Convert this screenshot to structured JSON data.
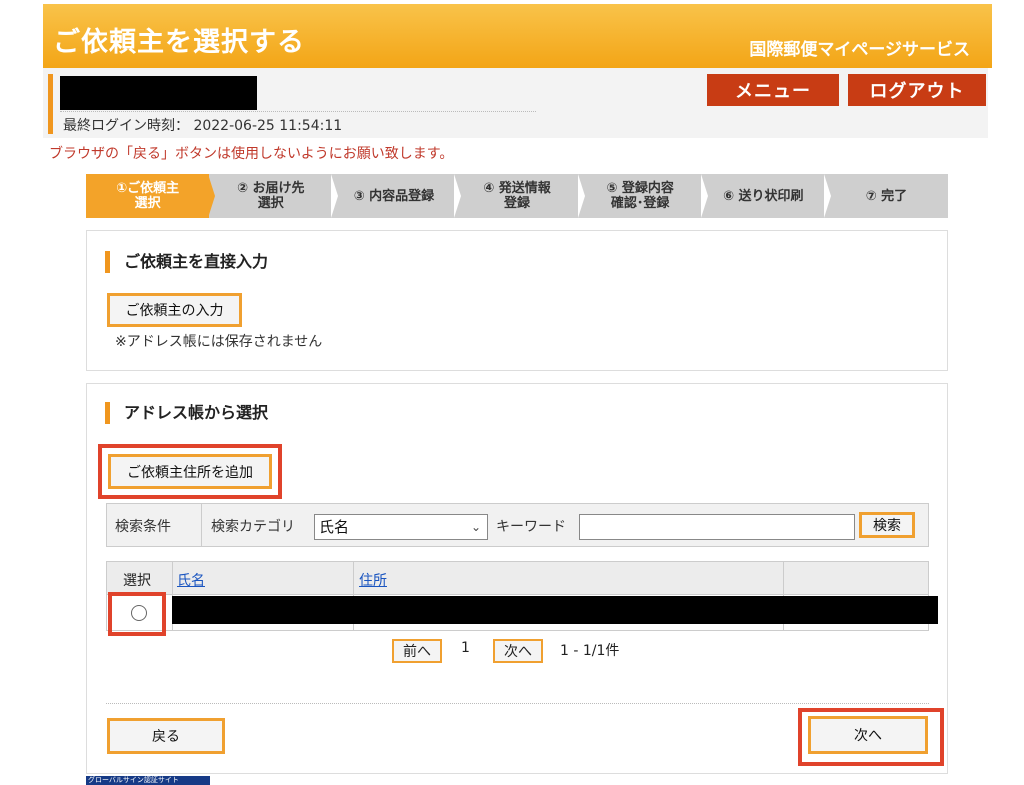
{
  "header": {
    "title": "ご依頼主を選択する",
    "service": "国際郵便マイページサービス"
  },
  "user": {
    "last_login_label": "最終ログイン時刻：",
    "last_login_value": "2022-06-25 11:54:11",
    "menu_label": "メニュー",
    "logout_label": "ログアウト"
  },
  "warning": "ブラウザの「戻る」ボタンは使用しないようにお願い致します。",
  "steps": [
    {
      "label": "①ご依頼主\n選択",
      "active": true
    },
    {
      "label": "② お届け先\n選択",
      "active": false
    },
    {
      "label": "③ 内容品登録",
      "active": false
    },
    {
      "label": "④ 発送情報\n登録",
      "active": false
    },
    {
      "label": "⑤ 登録内容\n確認･登録",
      "active": false
    },
    {
      "label": "⑥ 送り状印刷",
      "active": false
    },
    {
      "label": "⑦ 完了",
      "active": false
    }
  ],
  "direct": {
    "title": "ご依頼主を直接入力",
    "button": "ご依頼主の入力",
    "note": "※アドレス帳には保存されません"
  },
  "address_book": {
    "title": "アドレス帳から選択",
    "add_button": "ご依頼主住所を追加",
    "search": {
      "condition_label": "検索条件",
      "category_label": "検索カテゴリ",
      "category_value": "氏名",
      "keyword_label": "キーワード",
      "keyword_value": "",
      "search_button": "検索"
    },
    "table": {
      "col_select": "選択",
      "col_name": "氏名",
      "col_address": "住所"
    },
    "pager": {
      "prev": "前へ",
      "page": "1",
      "next": "次へ",
      "range": "1 - 1/1件"
    }
  },
  "nav": {
    "back": "戻る",
    "next": "次へ"
  },
  "footer": {
    "globalsign": "グローバルサイン認証サイト"
  },
  "colors": {
    "accent_orange": "#f3a329",
    "header_red": "#c83c14",
    "highlight_red": "#e0432b",
    "warning_red": "#c0392b"
  }
}
